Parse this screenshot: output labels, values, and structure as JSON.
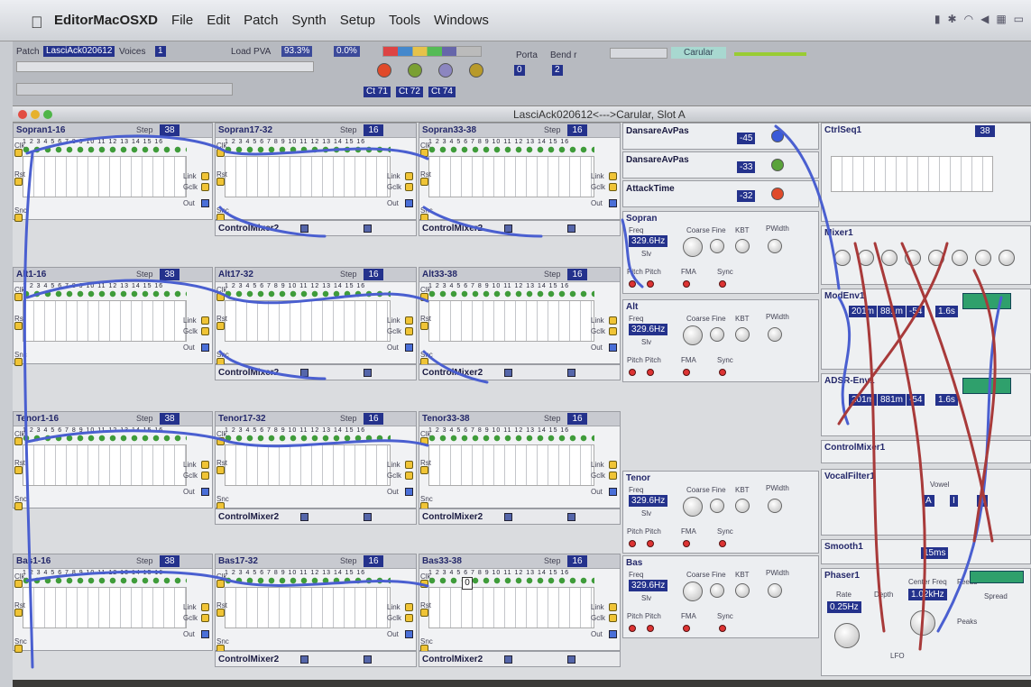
{
  "menubar": {
    "app": "EditorMacOSXD",
    "items": [
      "File",
      "Edit",
      "Patch",
      "Synth",
      "Setup",
      "Tools",
      "Windows"
    ]
  },
  "toolbar": {
    "patch_label": "Patch",
    "patch_name": "LasciAck020612",
    "voices_label": "Voices",
    "voices_value": "1",
    "load_label": "Load PVA",
    "load_value": "93.3%",
    "zero_value": "0.0%",
    "porta_label": "Porta",
    "porta_value": "0",
    "bend_label": "Bend r",
    "bend_value": "2",
    "preset_label": "Carular",
    "cc_labels": [
      "Ct 71",
      "Ct 72",
      "Ct 74"
    ]
  },
  "window": {
    "title": "LasciAck020612<--->Carular, Slot A"
  },
  "seq": {
    "sopran": [
      "Sopran1-16",
      "Sopran17-32",
      "Sopran33-38"
    ],
    "alt": [
      "Alt1-16",
      "Alt17-32",
      "Alt33-38"
    ],
    "tenor": [
      "Tenor1-16",
      "Tenor17-32",
      "Tenor33-38"
    ],
    "bas": [
      "Bas1-16",
      "Bas17-32",
      "Bas33-38"
    ],
    "step_label": "Step",
    "steps_a": "38",
    "steps_b": "16",
    "numbers": "1 2 3 4 5 6 7 8 9 10 11 12 13 14 15 16",
    "side_labels": [
      "Clk",
      "Rst",
      "Snc",
      "Link",
      "Gclk",
      "Out"
    ],
    "cursor_value": "0"
  },
  "mixer_label": "ControlMixer2",
  "ctrls": [
    {
      "name": "DansareAvPas",
      "value": "-45"
    },
    {
      "name": "DansareAvPas",
      "value": "-33"
    },
    {
      "name": "AttackTime",
      "value": "-32"
    }
  ],
  "oscs": [
    {
      "name": "Sopran"
    },
    {
      "name": "Alt"
    },
    {
      "name": "Tenor"
    },
    {
      "name": "Bas"
    }
  ],
  "osc_common": {
    "freq": "329.6Hz",
    "coarse": "Coarse",
    "fine": "Fine",
    "kbt": "KBT",
    "pwidth": "PWidth",
    "pitch": "Pitch",
    "fma": "FMA",
    "sync": "Sync",
    "slv": "Slv",
    "freq_label": "Freq"
  },
  "right": {
    "ctrlseq": "CtrlSeq1",
    "ctrlseq_steps": "38",
    "mixer1": "Mixer1",
    "mod_env": "ModEnv1",
    "adsr": "ADSR-Env1",
    "env_vals": [
      "201m",
      "881m",
      "-54",
      "1.6s"
    ],
    "ctrlmixer": "ControlMixer1",
    "vocal": "VocalFilter1",
    "vocal_vals": [
      "A",
      "I",
      "0"
    ],
    "vowel_label": "Vowel",
    "smooth": "Smooth1",
    "smooth_val": "15ms",
    "phaser": "Phaser1",
    "rate_label": "Rate",
    "rate_val": "0.25Hz",
    "depth": "Depth",
    "center": "Center Freq",
    "center_val": "1.02kHz",
    "feedb": "Feedb",
    "spread": "Spread",
    "peaks": "Peaks",
    "lfo": "LFO"
  },
  "colors": {
    "accent": "#24328c",
    "wire_blue": "#4a5fd0",
    "wire_red": "#a83a3a"
  }
}
